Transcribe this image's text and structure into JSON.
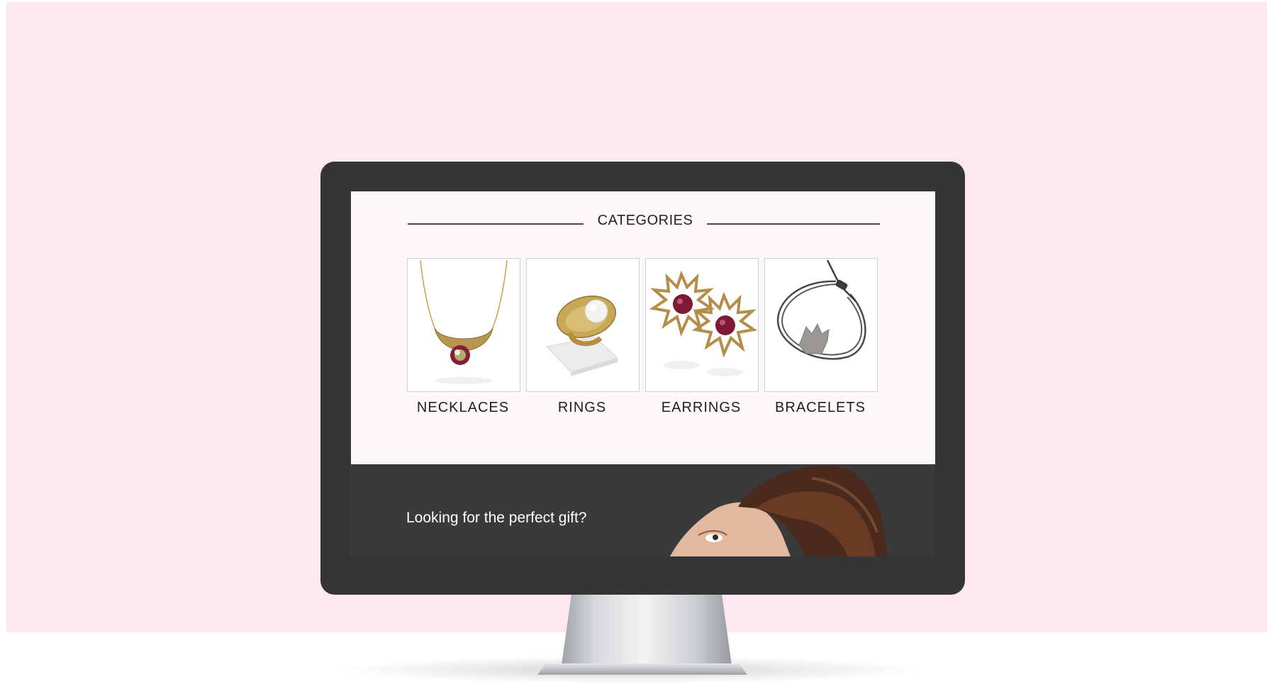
{
  "categories": {
    "heading": "CATEGORIES",
    "items": [
      {
        "label": "NECKLACES",
        "image": "necklace-image"
      },
      {
        "label": "RINGS",
        "image": "ring-image"
      },
      {
        "label": "EARRINGS",
        "image": "earrings-image"
      },
      {
        "label": "BRACELETS",
        "image": "bracelet-image"
      }
    ]
  },
  "promo": {
    "text": "Looking for the perfect gift?"
  },
  "colors": {
    "page_background": "#fce8ee",
    "monitor_bezel": "#353535",
    "panel_background": "#fdf8f9",
    "promo_background": "#3a3a3a",
    "gem_accent": "#8a1d38"
  }
}
